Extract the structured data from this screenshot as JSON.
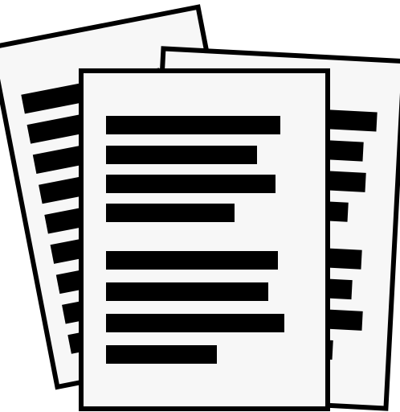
{
  "icon": {
    "name": "stacked-documents-icon",
    "colors": {
      "paper": "#f7f7f7",
      "ink": "#000000",
      "background": "#ffffff"
    },
    "sheets": [
      {
        "name": "back-left-sheet",
        "text_lines": 9
      },
      {
        "name": "back-right-sheet",
        "text_lines": 8
      },
      {
        "name": "front-sheet",
        "text_lines": 8
      }
    ]
  }
}
